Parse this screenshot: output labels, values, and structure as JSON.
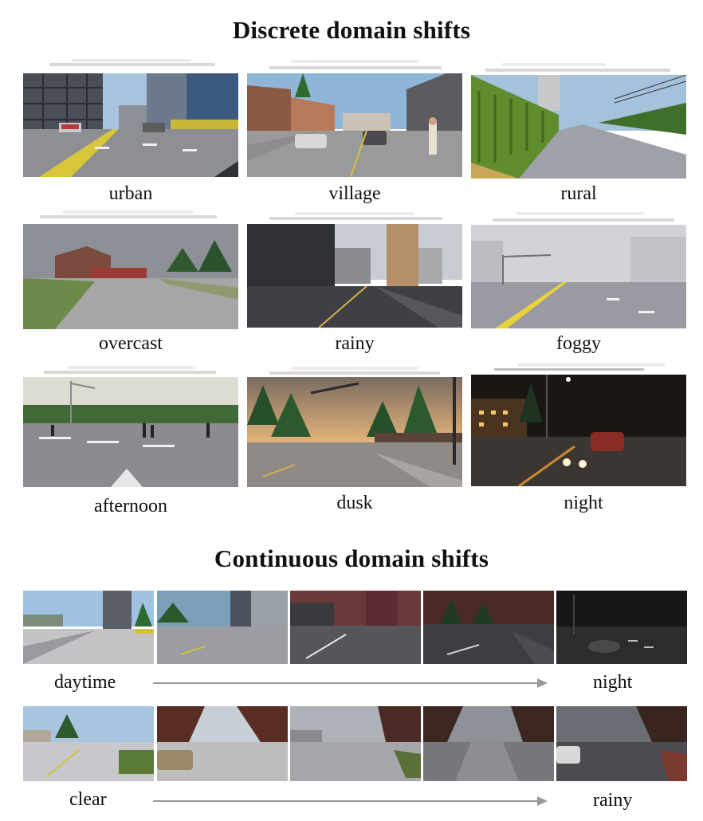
{
  "discrete": {
    "title": "Discrete domain shifts",
    "labels": [
      "urban",
      "village",
      "rural",
      "overcast",
      "rainy",
      "foggy",
      "afternoon",
      "dusk",
      "night"
    ]
  },
  "continuous": {
    "title": "Continuous domain shifts",
    "rows": [
      {
        "start_label": "daytime",
        "end_label": "night"
      },
      {
        "start_label": "clear",
        "end_label": "rainy"
      }
    ]
  }
}
